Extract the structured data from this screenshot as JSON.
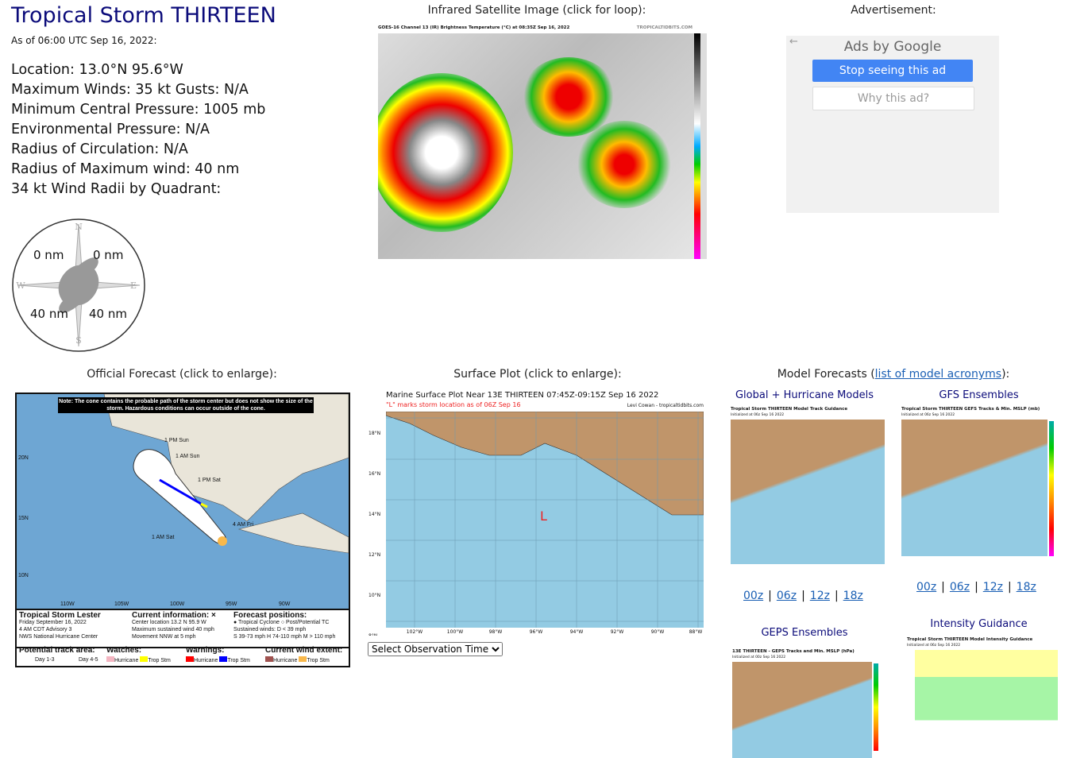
{
  "storm": {
    "title": "Tropical Storm THIRTEEN",
    "as_of": "As of 06:00 UTC Sep 16, 2022:",
    "lines": [
      "Location: 13.0°N 95.6°W",
      "Maximum Winds: 35 kt  Gusts: N/A",
      "Minimum Central Pressure: 1005 mb",
      "Environmental Pressure: N/A",
      "Radius of Circulation: N/A",
      "Radius of Maximum wind: 40 nm",
      "34 kt Wind Radii by Quadrant:"
    ]
  },
  "wind_radii": {
    "ne": "0 nm",
    "nw": "0 nm",
    "se": "40 nm",
    "sw": "40 nm",
    "compass": {
      "n": "N",
      "s": "S",
      "e": "E",
      "w": "W"
    }
  },
  "satellite": {
    "caption": "Infrared Satellite Image (click for loop):",
    "title": "GOES-16 Channel 13 (IR) Brightness Temperature (°C) at 08:35Z Sep 16, 2022",
    "credit": "TROPICALTIDBITS.COM"
  },
  "ad": {
    "caption": "Advertisement:",
    "ads_by": "Ads by Google",
    "stop": "Stop seeing this ad",
    "why": "Why this ad?"
  },
  "official": {
    "caption": "Official Forecast (click to enlarge):",
    "note": "Note: The cone contains the probable path of the storm center but does not show the size of the storm. Hazardous conditions can occur outside of the cone.",
    "labels": [
      "1 PM Sun",
      "1 AM Sun",
      "1 PM Sat",
      "1 AM Sat",
      "4 AM Fri"
    ],
    "lat": [
      "20N",
      "15N",
      "10N"
    ],
    "lon": [
      "110W",
      "105W",
      "100W",
      "95W",
      "90W"
    ],
    "name": "Tropical Storm Lester",
    "date": "Friday September 16, 2022",
    "advisory": "4 AM CDT Advisory 3",
    "center": "NWS National Hurricane Center",
    "current_title": "Current information: ×",
    "current": [
      "Center location 13.2 N 95.9 W",
      "Maximum sustained wind 40 mph",
      "Movement NNW at 5 mph"
    ],
    "forecast_title": "Forecast positions:",
    "forecast": [
      "● Tropical Cyclone  ○ Post/Potential TC",
      "Sustained winds:      D < 39 mph",
      "S 39-73 mph  H 74-110 mph  M > 110 mph"
    ],
    "track_title": "Potential track area:",
    "track": [
      "Day 1-3",
      "Day 4-5"
    ],
    "watches_title": "Watches:",
    "warnings_title": "Warnings:",
    "extent_title": "Current wind extent:",
    "watches": [
      {
        "label": "Hurricane",
        "color": "#f4b6c2"
      },
      {
        "label": "Trop Stm",
        "color": "#ffff00"
      }
    ],
    "warnings": [
      {
        "label": "Hurricane",
        "color": "#ff0000"
      },
      {
        "label": "Trop Stm",
        "color": "#0000ff"
      }
    ],
    "extent": [
      {
        "label": "Hurricane",
        "color": "#a0524f"
      },
      {
        "label": "Trop Stm",
        "color": "#f9b84a"
      }
    ]
  },
  "surface": {
    "caption": "Surface Plot (click to enlarge):",
    "title": "Marine Surface Plot Near 13E THIRTEEN 07:45Z-09:15Z Sep 16 2022",
    "subtitle": "\"L\" marks storm location as of 06Z Sep 16",
    "credit": "Levi Cowan - tropicaltidbits.com",
    "marker": "L",
    "lat": [
      "18°N",
      "16°N",
      "14°N",
      "12°N",
      "10°N",
      "8°N"
    ],
    "lon": [
      "102°W",
      "100°W",
      "98°W",
      "96°W",
      "94°W",
      "92°W",
      "90°W",
      "88°W"
    ],
    "select": "Select Observation Time..."
  },
  "models": {
    "caption_prefix": "Model Forecasts (",
    "link": "list of model acronyms",
    "caption_suffix": "):",
    "global": {
      "title": "Global + Hurricane Models",
      "img_title": "Tropical Storm THIRTEEN Model Track Guidance",
      "init": "Initialized at 06z Sep 16 2022",
      "times": [
        "00z",
        "06z",
        "12z",
        "18z"
      ]
    },
    "gfs": {
      "title": "GFS Ensembles",
      "img_title": "Tropical Storm THIRTEEN GEFS Tracks & Min. MSLP (mb)",
      "init": "Initialized at 06z Sep 16 2022",
      "times": [
        "00z",
        "06z",
        "12z",
        "18z"
      ]
    },
    "geps": {
      "title": "GEPS Ensembles",
      "img_title": "13E THIRTEEN - GEPS Tracks and Min. MSLP (hPa)",
      "init": "Initialized at 00z Sep 16 2022"
    },
    "intensity": {
      "title": "Intensity Guidance",
      "img_title": "Tropical Storm THIRTEEN Model Intensity Guidance",
      "init": "Initialized at 06z Sep 16 2022"
    }
  }
}
